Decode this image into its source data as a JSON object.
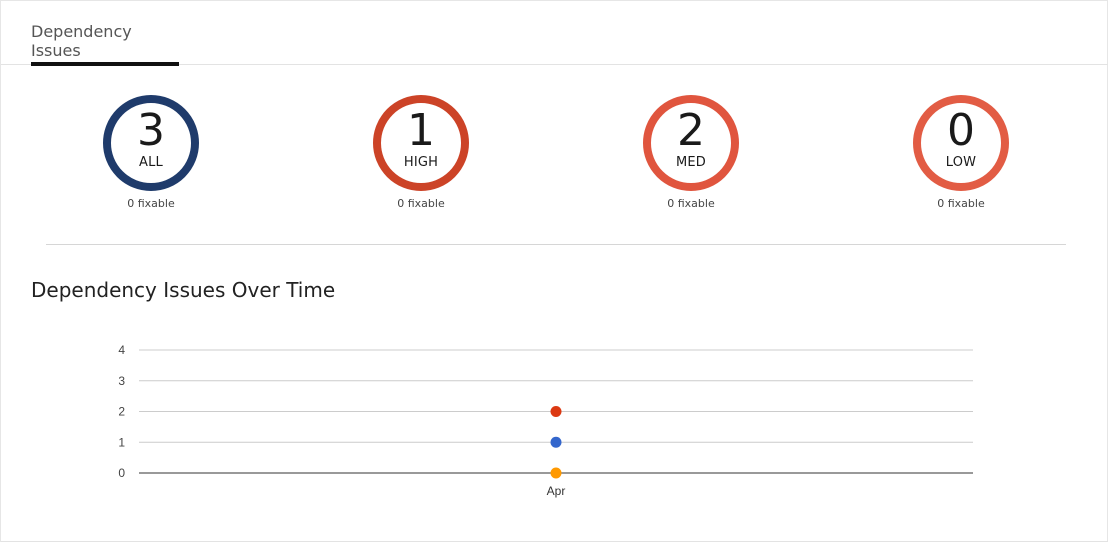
{
  "tabs": [
    {
      "label": "Dependency Issues",
      "active": true
    }
  ],
  "summary": [
    {
      "count": "3",
      "label": "ALL",
      "fixable": "0 fixable",
      "color": "#1f3b6b"
    },
    {
      "count": "1",
      "label": "HIGH",
      "fixable": "0 fixable",
      "color": "#cc4327"
    },
    {
      "count": "2",
      "label": "MED",
      "fixable": "0 fixable",
      "color": "#e0553e"
    },
    {
      "count": "0",
      "label": "LOW",
      "fixable": "0 fixable",
      "color": "#e25c44"
    }
  ],
  "section_title": "Dependency Issues Over Time",
  "chart_data": {
    "type": "scatter",
    "x": [
      "Apr"
    ],
    "ylim": [
      0,
      4
    ],
    "y_ticks": [
      "0",
      "1",
      "2",
      "3",
      "4"
    ],
    "x_ticks": [
      "Apr"
    ],
    "grid": true,
    "series": [
      {
        "values": [
          2
        ],
        "color": "#dc3912"
      },
      {
        "values": [
          1
        ],
        "color": "#3366cc"
      },
      {
        "values": [
          0
        ],
        "color": "#ff9900"
      }
    ]
  }
}
